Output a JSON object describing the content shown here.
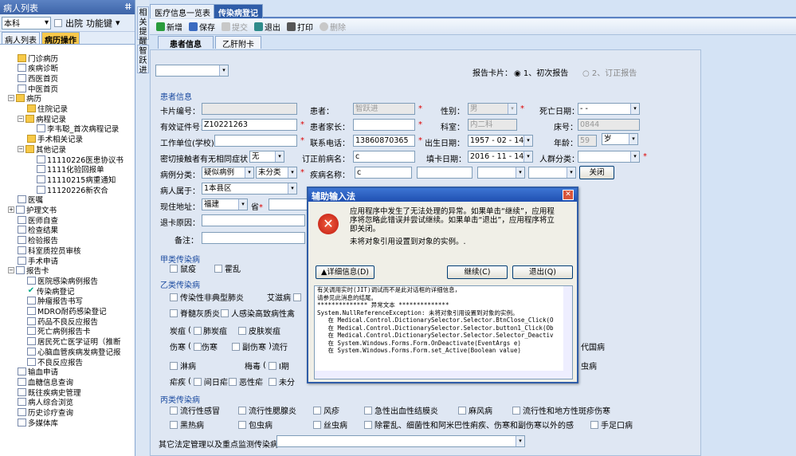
{
  "left": {
    "title": "病人列表",
    "pin": "ⵌ",
    "dept": "本科",
    "discharge_label": "出院",
    "func_key_label": "功能键",
    "tabs": [
      "病人列表",
      "病历操作"
    ],
    "tree": [
      "门诊病历",
      "疾病诊断",
      "西医首页",
      "中医首页",
      "病历",
      "住院记录",
      "病程记录",
      "李韦聪_首次病程记录",
      "手术相关记录",
      "其他记录",
      "11110226医患协议书",
      "1111化验回报单",
      "11110215病重通知",
      "11120226新农合",
      "医嘱",
      "护理文书",
      "医师自查",
      "检查结果",
      "检验报告",
      "科室质控员审核",
      "手术申请",
      "报告卡",
      "医院感染病例报告",
      "传染病登记",
      "肿瘤报告书写",
      "MDRO耐药感染登记",
      "药品不良反应报告",
      "死亡病例报告卡",
      "居民死亡医学证明（推断",
      "心脑血管疾病发病登记报",
      "不良反应报告",
      "输血申请",
      "血糖信息查询",
      "既往疾病史管理",
      "病人综合浏览",
      "历史诊疗查询",
      "多媒体库"
    ]
  },
  "vtabs": [
    "相关提醒",
    "智跃进"
  ],
  "doc_tabs": [
    "医疗信息一览表",
    "传染病登记"
  ],
  "toolbar": [
    "新增",
    "保存",
    "提交",
    "退出",
    "打印",
    "删除"
  ],
  "sub_tabs": [
    "患者信息",
    "乙肝附卡"
  ],
  "form": {
    "report_card_label": "报告卡片：",
    "radio1": "1、初次报告",
    "radio2": "2、订正报告",
    "section_patient": "患者信息",
    "card_no": "卡片编号：",
    "patient": "患者：",
    "patient_val": "智跃进",
    "sex": "性别：",
    "sex_val": "男",
    "death_date": "死亡日期：",
    "death_val": "-  -",
    "id_no": "有效证件号：",
    "id_val": "Z10221263",
    "guardian": "患者家长：",
    "dept": "科室：",
    "dept_val": "内二科",
    "bed": "床号：",
    "bed_val": "0844",
    "work": "工作单位(学校)：",
    "phone": "联系电话：",
    "phone_val": "13860870365",
    "birth": "出生日期：",
    "birth_val": "1957 - 02 - 14",
    "age": "年龄：",
    "age_val": "59",
    "age_unit": "岁",
    "close_contact": "密切接触者有无相同症状",
    "cc_val": "无",
    "corrected": "订正前病名：",
    "corrected_val": "c",
    "fill_date": "填卡日期：",
    "fill_val": "2016 - 11 - 14",
    "crowd": "人群分类：",
    "case_class": "病例分类：",
    "case_val1": "疑似病例",
    "case_val2": "未分类",
    "disease": "疾病名称：",
    "disease_val": "c",
    "close_btn": "关闭",
    "belong": "病人属于：",
    "belong_val": "1本县区",
    "addr": "现住地址：",
    "addr_val": "福建",
    "prov": "省",
    "back_reason": "退卡原因：",
    "remark": "备注：",
    "section_a": "甲类传染病",
    "a_items": [
      "鼠疫",
      "霍乱"
    ],
    "section_b": "乙类传染病",
    "b_items": [
      "传染性非典型肺炎",
      "艾滋病",
      "脊髓灰质炎",
      "人感染高致病性禽",
      "炭疽",
      "肺炭疽",
      "皮肤炭疽",
      "伤寒",
      "伤寒",
      "副伤寒",
      "流行",
      "淋病",
      "梅毒",
      "I期",
      "疟疾",
      "间日疟",
      "恶性疟",
      "未分"
    ],
    "b_extra": [
      "代国病",
      "虫病"
    ],
    "section_c": "丙类传染病",
    "c_items": [
      "流行性感冒",
      "流行性腮腺炎",
      "风疹",
      "急性出血性结膜炎",
      "麻风病",
      "流行性和地方性斑疹伤寒",
      "黑热病",
      "包虫病",
      "丝虫病",
      "除霍乱、细菌性和阿米巴性痢疾、伤寒和副伤寒以外的感",
      "手足口病"
    ],
    "other_label": "其它法定管理以及重点监测传染病"
  },
  "dialog": {
    "title": "辅助输入法",
    "msg1": "应用程序中发生了无法处理的异常。如果单击“继续”，应用程",
    "msg2": "序将忽略此错误并尝试继续。如果单击“退出”，应用程序将立",
    "msg3": "即关闭。",
    "msg4": "未将对象引用设置到对象的实例。.",
    "details": "▲详细信息(D)",
    "continue": "继续(C)",
    "quit": "退出(Q)",
    "trace": [
      "有关调用实时(JIT)调试而不是此对话框的详细信息，",
      "请参见此消息的结尾。",
      "",
      "************** 异常文本 **************",
      "System.NullReferenceException: 未将对象引用设置到对象的实例。",
      "   在 Medical.Control.DictionarySelector.Selector.BtnClose_Click(O",
      "   在 Medical.Control.DictionarySelector.Selector.button1_Click(Ob",
      "   在 Medical.Control.DictionarySelector.Selector.Selector_Deactiv",
      "   在 System.Windows.Forms.Form.OnDeactivate(EventArgs e)",
      "   在 System.Windows.Forms.Form.set_Active(Boolean value)"
    ]
  }
}
